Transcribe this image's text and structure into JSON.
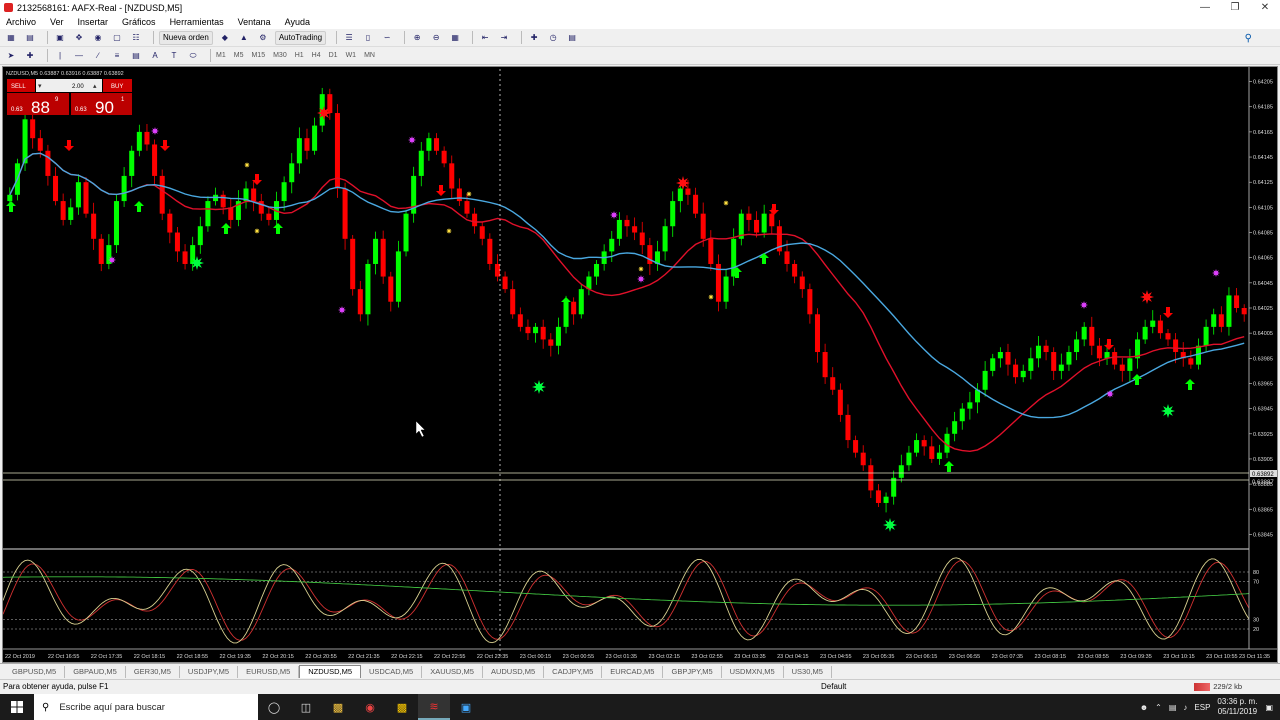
{
  "window": {
    "title": "2132568161: AAFX-Real - [NZDUSD,M5]",
    "minimize": "—",
    "maximize": "❐",
    "close": "✕"
  },
  "menu": [
    "Archivo",
    "Ver",
    "Insertar",
    "Gráficos",
    "Herramientas",
    "Ventana",
    "Ayuda"
  ],
  "toolbar": {
    "new_order": "Nueva orden",
    "autotrading": "AutoTrading",
    "timeframes": [
      "M1",
      "M5",
      "M15",
      "M30",
      "H1",
      "H4",
      "D1",
      "W1",
      "MN"
    ]
  },
  "chart": {
    "header": "NZDUSD,M5  0.63887 0.63916 0.63887 0.63892",
    "trade_panel": {
      "sell_label": "SELL",
      "buy_label": "BUY",
      "lot": "2.00",
      "sell_prefix": "0.63",
      "sell_big": "88",
      "sell_sup": "9",
      "buy_prefix": "0.63",
      "buy_big": "90",
      "buy_sup": "1"
    },
    "price_labels": [
      "0.64205",
      "0.64185",
      "0.64165",
      "0.64145",
      "0.64125",
      "0.64105",
      "0.64085",
      "0.64065",
      "0.64045",
      "0.64025",
      "0.64005",
      "0.63985",
      "0.63965",
      "0.63945",
      "0.63925",
      "0.63905",
      "0.63885",
      "0.63865",
      "0.63845"
    ],
    "current_price": "0.63892",
    "current_price2": "0.63887",
    "stoch_levels": [
      "80",
      "70",
      "30",
      "20"
    ],
    "time_labels": [
      "22 Oct 2019",
      "22 Oct 16:55",
      "22 Oct 17:35",
      "22 Oct 18:15",
      "22 Oct 18:55",
      "22 Oct 19:35",
      "22 Oct 20:15",
      "22 Oct 20:55",
      "22 Oct 21:35",
      "22 Oct 22:15",
      "22 Oct 22:55",
      "22 Oct 23:35",
      "23 Oct 00:15",
      "23 Oct 00:55",
      "23 Oct 01:35",
      "23 Oct 02:15",
      "23 Oct 02:55",
      "23 Oct 03:35",
      "23 Oct 04:15",
      "23 Oct 04:55",
      "23 Oct 05:35",
      "23 Oct 06:15",
      "23 Oct 06:55",
      "23 Oct 07:35",
      "23 Oct 08:15",
      "23 Oct 08:55",
      "23 Oct 09:35",
      "23 Oct 10:15",
      "23 Oct 10:55",
      "23 Oct 11:35"
    ],
    "colors": {
      "bull": "#00ff00",
      "bear": "#ff0000",
      "ma_red": "#e0102a",
      "ma_blue": "#4aa8e0",
      "star_green": "#00ff40",
      "star_red": "#ff1010",
      "star_magenta": "#e040ff",
      "star_yellow": "#ffe040"
    }
  },
  "chart_data": {
    "type": "candlestick",
    "symbol": "NZDUSD",
    "timeframe": "M5",
    "ylim": [
      0.63835,
      0.64215
    ],
    "close": [
      0.64115,
      0.6414,
      0.64175,
      0.6416,
      0.6415,
      0.6413,
      0.6411,
      0.64095,
      0.64105,
      0.64125,
      0.641,
      0.6408,
      0.6406,
      0.64075,
      0.6411,
      0.6413,
      0.6415,
      0.64165,
      0.64155,
      0.6413,
      0.641,
      0.64085,
      0.6407,
      0.6406,
      0.64075,
      0.6409,
      0.6411,
      0.64115,
      0.64105,
      0.64095,
      0.6411,
      0.6412,
      0.6411,
      0.641,
      0.64095,
      0.6411,
      0.64125,
      0.6414,
      0.6416,
      0.6415,
      0.6417,
      0.64195,
      0.6418,
      0.6412,
      0.6408,
      0.6404,
      0.6402,
      0.6406,
      0.6408,
      0.6405,
      0.6403,
      0.6407,
      0.641,
      0.6413,
      0.6415,
      0.6416,
      0.6415,
      0.6414,
      0.6412,
      0.6411,
      0.641,
      0.6409,
      0.6408,
      0.6406,
      0.6405,
      0.6404,
      0.6402,
      0.6401,
      0.64005,
      0.6401,
      0.64,
      0.63995,
      0.6401,
      0.6403,
      0.6402,
      0.6404,
      0.6405,
      0.6406,
      0.6407,
      0.6408,
      0.64095,
      0.6409,
      0.64085,
      0.64075,
      0.6406,
      0.6407,
      0.6409,
      0.6411,
      0.6412,
      0.64115,
      0.641,
      0.6408,
      0.6406,
      0.6403,
      0.6405,
      0.6408,
      0.641,
      0.64095,
      0.64085,
      0.641,
      0.6409,
      0.6407,
      0.6406,
      0.6405,
      0.6404,
      0.6402,
      0.6399,
      0.6397,
      0.6396,
      0.6394,
      0.6392,
      0.6391,
      0.639,
      0.6388,
      0.6387,
      0.63875,
      0.6389,
      0.639,
      0.6391,
      0.6392,
      0.63915,
      0.63905,
      0.6391,
      0.63925,
      0.63935,
      0.63945,
      0.6395,
      0.6396,
      0.63975,
      0.63985,
      0.6399,
      0.6398,
      0.6397,
      0.63975,
      0.63985,
      0.63995,
      0.6399,
      0.63975,
      0.6398,
      0.6399,
      0.64,
      0.6401,
      0.63995,
      0.63985,
      0.6399,
      0.6398,
      0.63975,
      0.63985,
      0.64,
      0.6401,
      0.64015,
      0.64005,
      0.64,
      0.6399,
      0.63985,
      0.6398,
      0.63995,
      0.6401,
      0.6402,
      0.6401,
      0.64035,
      0.64025,
      0.6402
    ]
  }
}
